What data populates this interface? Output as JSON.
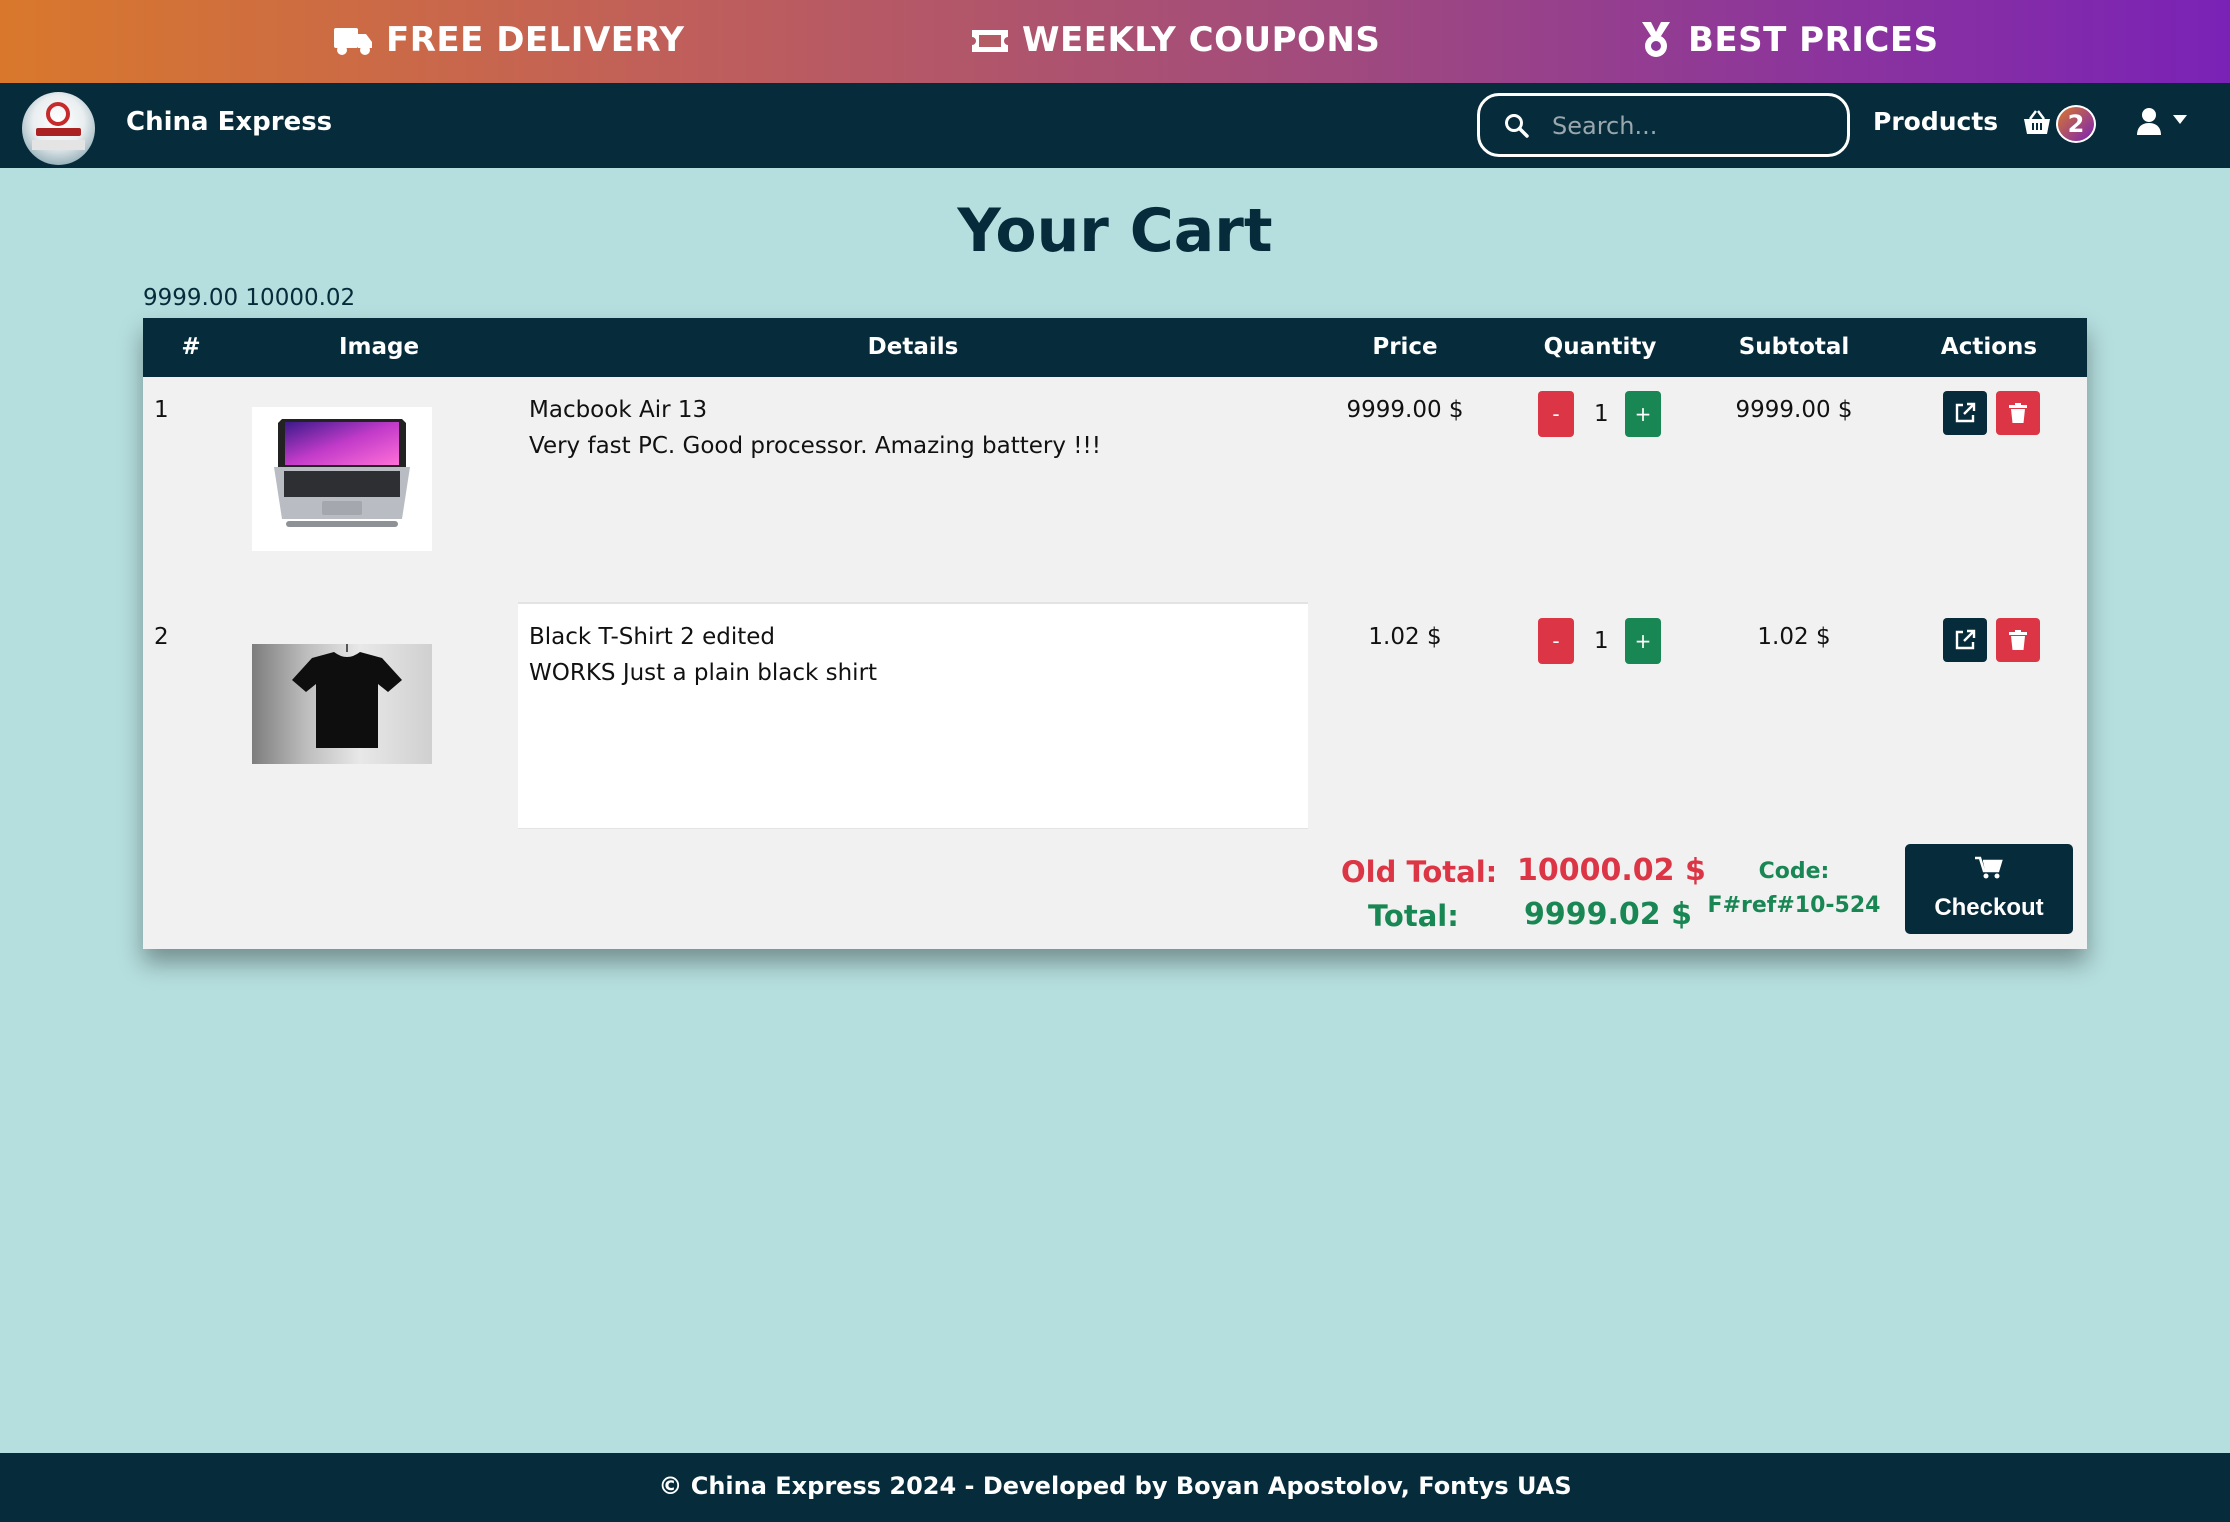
{
  "promo": {
    "items": [
      {
        "label": "FREE DELIVERY",
        "icon": "truck-icon"
      },
      {
        "label": "WEEKLY COUPONS",
        "icon": "ticket-icon"
      },
      {
        "label": "BEST PRICES",
        "icon": "medal-icon"
      }
    ]
  },
  "navbar": {
    "brand": "China Express",
    "search_placeholder": "Search...",
    "products_label": "Products",
    "cart_count": "2"
  },
  "page": {
    "title": "Your Cart",
    "debug_totals": "9999.00 10000.02"
  },
  "table": {
    "headers": [
      "#",
      "Image",
      "Details",
      "Price",
      "Quantity",
      "Subtotal",
      "Actions"
    ],
    "rows": [
      {
        "index": "1",
        "name": "Macbook Air 13",
        "description": "Very fast PC. Good processor. Amazing battery !!!",
        "price": "9999.00 $",
        "quantity": "1",
        "subtotal": "9999.00 $",
        "image": "laptop-image"
      },
      {
        "index": "2",
        "name": "Black T-Shirt 2 edited",
        "description": "WORKS Just a plain black shirt",
        "price": "1.02 $",
        "quantity": "1",
        "subtotal": "1.02 $",
        "image": "tshirt-image"
      }
    ],
    "minus_label": "-",
    "plus_label": "+"
  },
  "summary": {
    "old_total_label": "Old Total:",
    "old_total_value": "10000.02 $",
    "total_label": "Total:",
    "total_value": "9999.02 $",
    "code_label": "Code:",
    "code_value": "F#ref#10-524",
    "checkout_label": "Checkout"
  },
  "footer": {
    "text": "© China Express 2024 - Developed by Boyan Apostolov, Fontys UAS"
  },
  "colors": {
    "navy": "#062b3a",
    "background": "#b5dede",
    "danger": "#dc3545",
    "success": "#198754",
    "gradient_start": "#d9782c",
    "gradient_end": "#7a22b6"
  }
}
